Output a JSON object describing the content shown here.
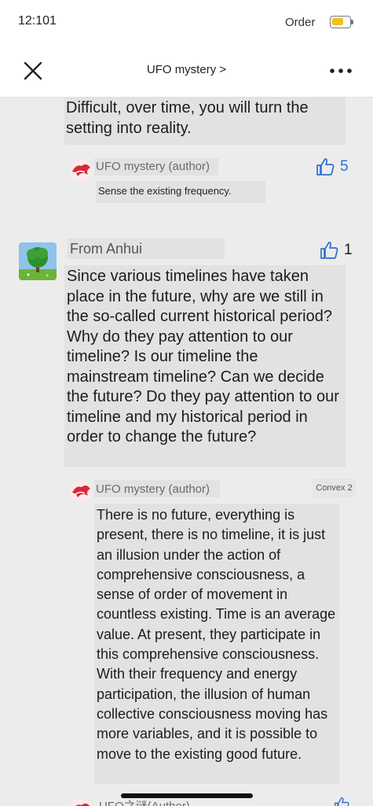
{
  "status_bar": {
    "time": "12:101",
    "carrier": "Order"
  },
  "nav": {
    "title": "UFO mystery >"
  },
  "post": {
    "text_tail": "Difficult, over time, you will turn the setting into reality.",
    "author_reply": {
      "name": "UFO mystery (author)",
      "text": "Sense the existing frequency.",
      "likes": "5"
    }
  },
  "comment": {
    "user": "From Anhui",
    "likes": "1",
    "text": "Since various timelines have taken place in the future, why are we still in the so-called current historical period? Why do they pay attention to our timeline? Is our timeline the mainstream timeline? Can we decide the future? Do they pay attention to our timeline and my historical period in order to change the future?",
    "reply": {
      "name": "UFO mystery (author)",
      "badge": "Convex 2",
      "text": "There is no future, everything is present, there is no timeline, it is just an illusion under the action of comprehensive consciousness, a sense of order of movement in countless existing. Time is an average value. At present, they participate in this comprehensive consciousness. With their frequency and energy participation, the illusion of human collective consciousness moving has more variables, and it is possible to move to the existing good future."
    }
  },
  "next_reply": {
    "name": "UFO之谜(Author)"
  },
  "colors": {
    "accent": "#2d6fd1",
    "battery": "#f1c21b"
  }
}
